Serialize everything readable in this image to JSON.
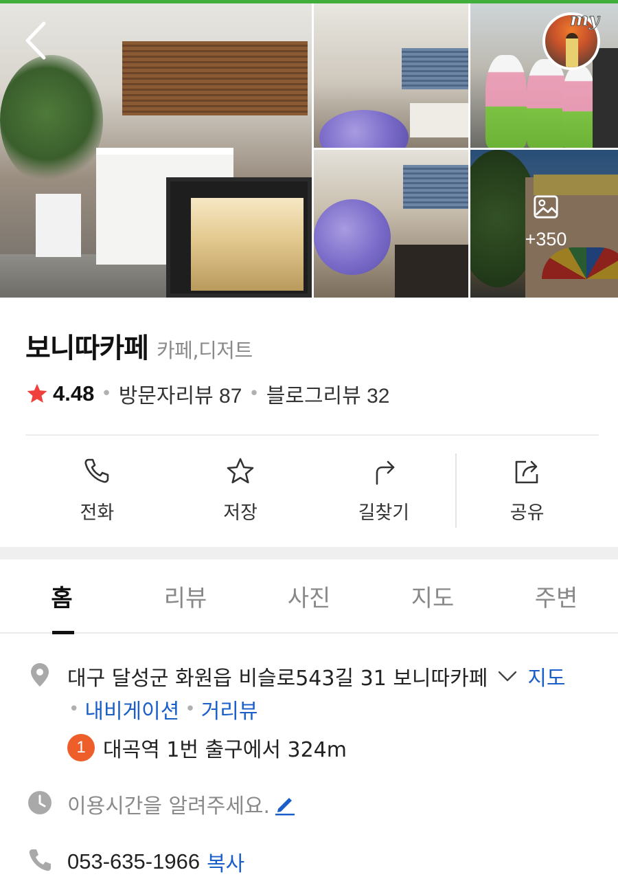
{
  "gallery": {
    "more_count": "+350",
    "badge_text": "my"
  },
  "place": {
    "name": "보니따카페",
    "category": "카페,디저트",
    "rating": "4.48",
    "visitor_reviews": "방문자리뷰 87",
    "blog_reviews": "블로그리뷰 32"
  },
  "actions": {
    "call": "전화",
    "save": "저장",
    "directions": "길찾기",
    "share": "공유"
  },
  "tabs": [
    "홈",
    "리뷰",
    "사진",
    "지도",
    "주변"
  ],
  "details": {
    "address": "대구 달성군 화원읍 비슬로543길 31 보니따카페",
    "map_link": "지도",
    "navigation_link": "내비게이션",
    "street_view_link": "거리뷰",
    "subway_line": "1",
    "subway_text": "대곡역 1번 출구에서 324m",
    "hours_prompt": "이용시간을 알려주세요.",
    "phone": "053-635-1966",
    "copy_label": "복사"
  },
  "colors": {
    "accent_green": "#3fae3b",
    "link_blue": "#1a5fc9",
    "star_red": "#f0403c",
    "subway_orange": "#ee5e2a"
  }
}
